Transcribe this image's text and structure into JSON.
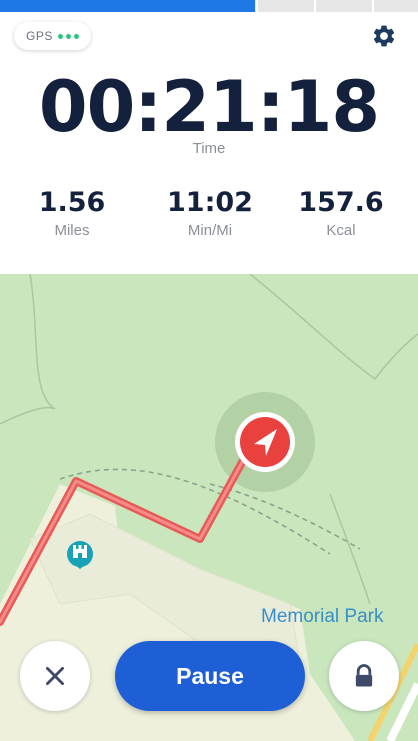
{
  "progress": {
    "fraction": 0.61,
    "segments": 4
  },
  "gps": {
    "label": "GPS",
    "signal_bars": 3
  },
  "timer": {
    "value": "00:21:18",
    "label": "Time"
  },
  "metrics": [
    {
      "value": "1.56",
      "label": "Miles"
    },
    {
      "value": "11:02",
      "label": "Min/Mi"
    },
    {
      "value": "157.6",
      "label": "Kcal"
    }
  ],
  "map": {
    "place_label": "Memorial Park",
    "colors": {
      "park": "#c9e6bd",
      "built": "#eef1dd",
      "route": "#e85a57",
      "label": "#3a8ec9"
    },
    "icons": [
      "castle-poi-icon",
      "location-arrow-icon"
    ]
  },
  "controls": {
    "pause_label": "Pause",
    "cancel_icon": "close-icon",
    "lock_icon": "lock-icon",
    "settings_icon": "gear-icon",
    "accent": "#1f5fd6"
  }
}
